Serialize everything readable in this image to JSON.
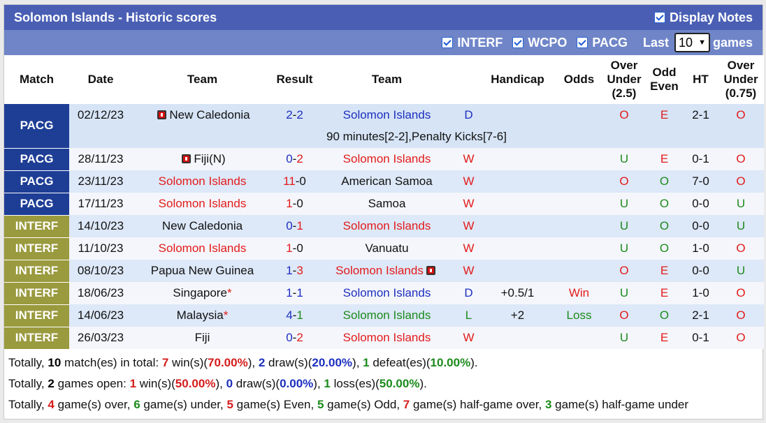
{
  "title": "Solomon Islands - Historic scores",
  "display_notes_label": "Display Notes",
  "filters": [
    {
      "label": "INTERF",
      "checked": true
    },
    {
      "label": "WCPO",
      "checked": true
    },
    {
      "label": "PACG",
      "checked": true
    }
  ],
  "last_label": "Last",
  "last_value": "10",
  "games_label": "games",
  "headers": {
    "match": "Match",
    "date": "Date",
    "team1": "Team",
    "result": "Result",
    "team2": "Team",
    "handicap": "Handicap",
    "odds": "Odds",
    "ou25_l1": "Over",
    "ou25_l2": "Under",
    "ou25_l3": "(2.5)",
    "oe_l1": "Odd",
    "oe_l2": "Even",
    "ht": "HT",
    "ou075_l1": "Over",
    "ou075_l2": "Under",
    "ou075_l3": "(0.75)"
  },
  "rows": [
    {
      "comp": "PACG",
      "date": "02/12/23",
      "team1": "New Caledonia",
      "team1_flag": true,
      "team1_star": "",
      "score_home": "2",
      "score_away": "2",
      "team2": "Solomon Islands",
      "team2_flag": false,
      "wl": "D",
      "handicap": "",
      "odds": "",
      "ou": "O",
      "oe": "E",
      "ht": "2-1",
      "ou2": "O",
      "note": "90 minutes[2-2],Penalty Kicks[7-6]"
    },
    {
      "comp": "PACG",
      "date": "28/11/23",
      "team1": "Fiji(N)",
      "team1_flag": true,
      "team1_star": "",
      "score_home": "0",
      "score_away": "2",
      "team2": "Solomon Islands",
      "team2_flag": false,
      "wl": "W",
      "handicap": "",
      "odds": "",
      "ou": "U",
      "oe": "E",
      "ht": "0-1",
      "ou2": "O"
    },
    {
      "comp": "PACG",
      "date": "23/11/23",
      "team1": "Solomon Islands",
      "team1_flag": false,
      "team1_star": "",
      "score_home": "11",
      "score_away": "0",
      "team2": "American Samoa",
      "team2_flag": false,
      "wl": "W",
      "handicap": "",
      "odds": "",
      "ou": "O",
      "oe": "O",
      "ht": "7-0",
      "ou2": "O"
    },
    {
      "comp": "PACG",
      "date": "17/11/23",
      "team1": "Solomon Islands",
      "team1_flag": false,
      "team1_star": "",
      "score_home": "1",
      "score_away": "0",
      "team2": "Samoa",
      "team2_flag": false,
      "wl": "W",
      "handicap": "",
      "odds": "",
      "ou": "U",
      "oe": "O",
      "ht": "0-0",
      "ou2": "U"
    },
    {
      "comp": "INTERF",
      "date": "14/10/23",
      "team1": "New Caledonia",
      "team1_flag": false,
      "team1_star": "",
      "score_home": "0",
      "score_away": "1",
      "team2": "Solomon Islands",
      "team2_flag": false,
      "wl": "W",
      "handicap": "",
      "odds": "",
      "ou": "U",
      "oe": "O",
      "ht": "0-0",
      "ou2": "U"
    },
    {
      "comp": "INTERF",
      "date": "11/10/23",
      "team1": "Solomon Islands",
      "team1_flag": false,
      "team1_star": "",
      "score_home": "1",
      "score_away": "0",
      "team2": "Vanuatu",
      "team2_flag": false,
      "wl": "W",
      "handicap": "",
      "odds": "",
      "ou": "U",
      "oe": "O",
      "ht": "1-0",
      "ou2": "O"
    },
    {
      "comp": "INTERF",
      "date": "08/10/23",
      "team1": "Papua New Guinea",
      "team1_flag": false,
      "team1_star": "",
      "score_home": "1",
      "score_away": "3",
      "team2": "Solomon Islands",
      "team2_flag": true,
      "wl": "W",
      "handicap": "",
      "odds": "",
      "ou": "O",
      "oe": "E",
      "ht": "0-0",
      "ou2": "U"
    },
    {
      "comp": "INTERF",
      "date": "18/06/23",
      "team1": "Singapore",
      "team1_flag": false,
      "team1_star": "*",
      "score_home": "1",
      "score_away": "1",
      "team2": "Solomon Islands",
      "team2_flag": false,
      "wl": "D",
      "handicap": "+0.5/1",
      "odds": "Win",
      "ou": "U",
      "oe": "E",
      "ht": "1-0",
      "ou2": "O"
    },
    {
      "comp": "INTERF",
      "date": "14/06/23",
      "team1": "Malaysia",
      "team1_flag": false,
      "team1_star": "*",
      "score_home": "4",
      "score_away": "1",
      "team2": "Solomon Islands",
      "team2_flag": false,
      "wl": "L",
      "handicap": "+2",
      "odds": "Loss",
      "ou": "O",
      "oe": "O",
      "ht": "2-1",
      "ou2": "O"
    },
    {
      "comp": "INTERF",
      "date": "26/03/23",
      "team1": "Fiji",
      "team1_flag": false,
      "team1_star": "",
      "score_home": "0",
      "score_away": "2",
      "team2": "Solomon Islands",
      "team2_flag": false,
      "wl": "W",
      "handicap": "",
      "odds": "",
      "ou": "U",
      "oe": "E",
      "ht": "0-1",
      "ou2": "O"
    }
  ],
  "colors": {
    "title_bg": "#4a5fb4",
    "filter_bg": "#6f85c8",
    "pacg_bg": "#1e3e96",
    "interf_bg": "#9a9a3e",
    "win": "#e31b1b",
    "draw": "#1d2fbf",
    "loss": "#1c8a1c"
  },
  "summary": [
    [
      {
        "t": "Totally, ",
        "c": ""
      },
      {
        "t": "10",
        "c": "b"
      },
      {
        "t": " match(es) in total: ",
        "c": ""
      },
      {
        "t": "7",
        "c": "r"
      },
      {
        "t": " win(s)(",
        "c": ""
      },
      {
        "t": "70.00%",
        "c": "r"
      },
      {
        "t": "), ",
        "c": ""
      },
      {
        "t": "2",
        "c": "bl"
      },
      {
        "t": " draw(s)(",
        "c": ""
      },
      {
        "t": "20.00%",
        "c": "bl"
      },
      {
        "t": "), ",
        "c": ""
      },
      {
        "t": "1",
        "c": "g"
      },
      {
        "t": " defeat(es)(",
        "c": ""
      },
      {
        "t": "10.00%",
        "c": "g"
      },
      {
        "t": ").",
        "c": ""
      }
    ],
    [
      {
        "t": "Totally, ",
        "c": ""
      },
      {
        "t": "2",
        "c": "b"
      },
      {
        "t": " games open: ",
        "c": ""
      },
      {
        "t": "1",
        "c": "r"
      },
      {
        "t": " win(s)(",
        "c": ""
      },
      {
        "t": "50.00%",
        "c": "r"
      },
      {
        "t": "), ",
        "c": ""
      },
      {
        "t": "0",
        "c": "bl"
      },
      {
        "t": " draw(s)(",
        "c": ""
      },
      {
        "t": "0.00%",
        "c": "bl"
      },
      {
        "t": "), ",
        "c": ""
      },
      {
        "t": "1",
        "c": "g"
      },
      {
        "t": " loss(es)(",
        "c": ""
      },
      {
        "t": "50.00%",
        "c": "g"
      },
      {
        "t": ").",
        "c": ""
      }
    ],
    [
      {
        "t": "Totally, ",
        "c": ""
      },
      {
        "t": "4",
        "c": "r"
      },
      {
        "t": " game(s) over, ",
        "c": ""
      },
      {
        "t": "6",
        "c": "g"
      },
      {
        "t": " game(s) under, ",
        "c": ""
      },
      {
        "t": "5",
        "c": "r"
      },
      {
        "t": " game(s) Even, ",
        "c": ""
      },
      {
        "t": "5",
        "c": "g"
      },
      {
        "t": " game(s) Odd, ",
        "c": ""
      },
      {
        "t": "7",
        "c": "r"
      },
      {
        "t": " game(s) half-game over, ",
        "c": ""
      },
      {
        "t": "3",
        "c": "g"
      },
      {
        "t": " game(s) half-game under",
        "c": ""
      }
    ]
  ]
}
